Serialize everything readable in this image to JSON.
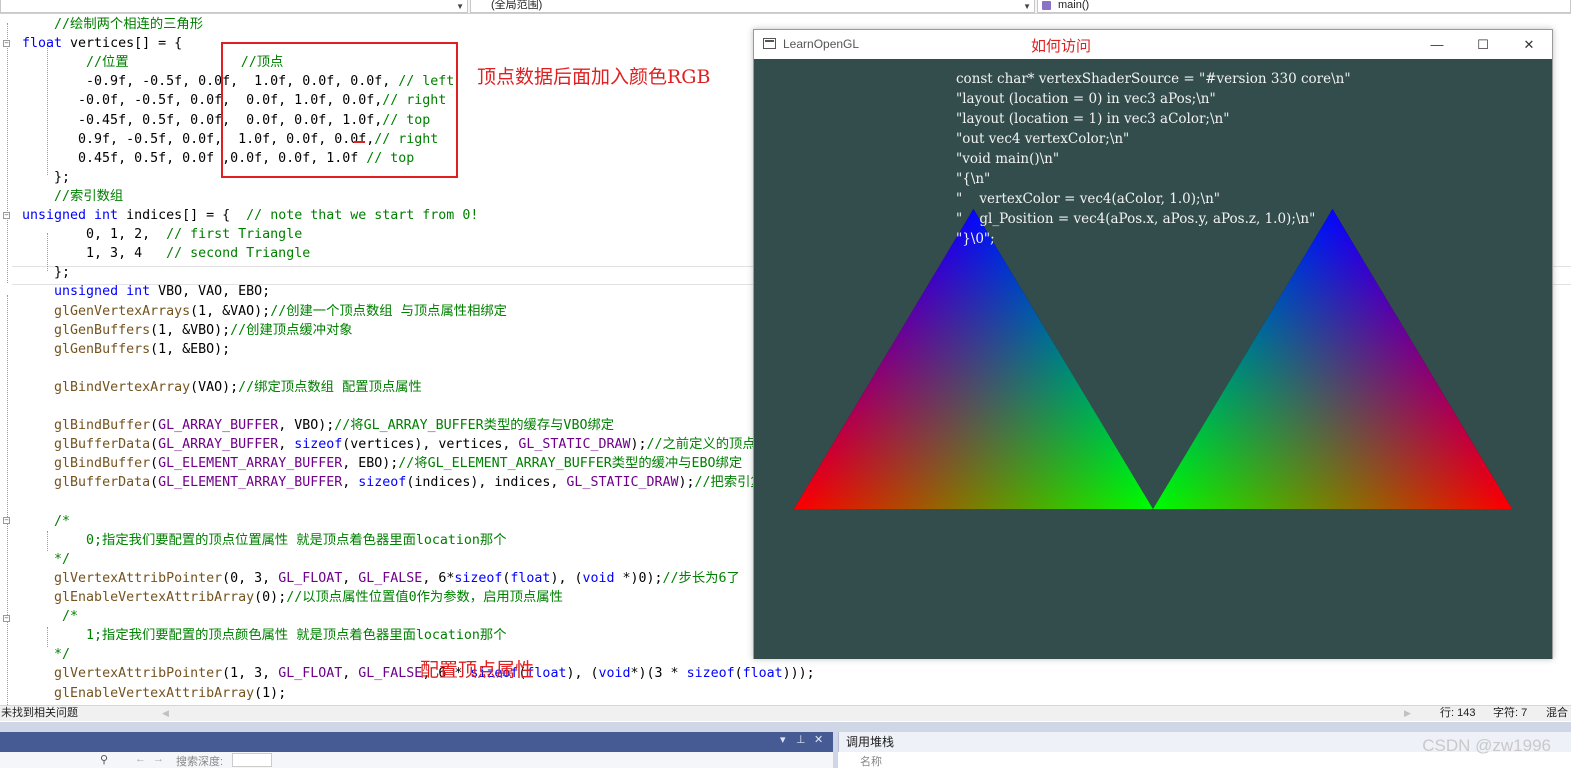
{
  "navbar": {
    "scope_combo": "(全局范围)",
    "function_combo": "main()"
  },
  "code_lines": [
    {
      "t": "    //绘制两个相连的三角形",
      "cls": "c-cm"
    },
    {
      "t": "    float vertices[] = {",
      "parts": [
        [
          "float",
          "c-kw"
        ],
        [
          " vertices[] = {",
          ""
        ]
      ]
    },
    {
      "t": "        //位置              //顶点",
      "cls": "c-cm"
    },
    {
      "t": "        -0.9f, -0.5f, 0.0f,  1.0f, 0.0f, 0.0f, // left",
      "parts": [
        [
          "        -0.9f, -0.5f, 0.0f,  1.0f, 0.0f, 0.0f, ",
          ""
        ],
        [
          "// left",
          "c-cm"
        ]
      ]
    },
    {
      "t": "       -0.0f, -0.5f, 0.0f,  0.0f, 1.0f, 0.0f,// right",
      "parts": [
        [
          "       -0.0f, -0.5f, 0.0f,  0.0f, 1.0f, 0.0f,",
          ""
        ],
        [
          "// right",
          "c-cm"
        ]
      ]
    },
    {
      "t": "       -0.45f, 0.5f, 0.0f,  0.0f, 0.0f, 1.0f,// top",
      "parts": [
        [
          "       -0.45f, 0.5f, 0.0f,  0.0f, 0.0f, 1.0f,",
          ""
        ],
        [
          "// top",
          "c-cm"
        ]
      ]
    },
    {
      "t": "       0.9f, -0.5f, 0.0f,  1.0f, 0.0f, 0.0f,// right",
      "parts": [
        [
          "       0.9f, -0.5f, 0.0f,  1.0f, 0.0f, 0.0f,",
          ""
        ],
        [
          "// right",
          "c-cm"
        ]
      ]
    },
    {
      "t": "       0.45f, 0.5f, 0.0f ,0.0f, 0.0f, 1.0f // top",
      "parts": [
        [
          "       0.45f, 0.5f, 0.0f ,0.0f, 0.0f, 1.0f ",
          ""
        ],
        [
          "// top",
          "c-cm"
        ]
      ]
    },
    {
      "t": "    };",
      "cls": ""
    },
    {
      "t": "    //索引数组",
      "cls": "c-cm"
    },
    {
      "t": "    unsigned int indices[] = {  // note that we start from 0!",
      "parts": [
        [
          "unsigned int",
          "c-kw"
        ],
        [
          " indices[] = {  ",
          ""
        ],
        [
          "// note that we start from 0!",
          "c-cm"
        ]
      ]
    },
    {
      "t": "        0, 1, 2,  // first Triangle",
      "parts": [
        [
          "        0, 1, 2,  ",
          ""
        ],
        [
          "// first Triangle",
          "c-cm"
        ]
      ]
    },
    {
      "t": "        1, 3, 4   // second Triangle",
      "parts": [
        [
          "        1, 3, 4   ",
          ""
        ],
        [
          "// second Triangle",
          "c-cm"
        ]
      ]
    },
    {
      "t": "    };",
      "cls": ""
    },
    {
      "t": "    unsigned int VBO, VAO, EBO;",
      "parts": [
        [
          "    ",
          ""
        ],
        [
          "unsigned int",
          "c-kw"
        ],
        [
          " VBO, VAO, EBO;",
          ""
        ]
      ]
    },
    {
      "t": "    glGenVertexArrays(1, &VAO);//创建一个顶点数组 与顶点属性相绑定",
      "parts": [
        [
          "    ",
          ""
        ],
        [
          "glGenVertexArrays",
          "c-fn"
        ],
        [
          "(1, &VAO);",
          ""
        ],
        [
          "//创建一个顶点数组 与顶点属性相绑定",
          "c-cm"
        ]
      ]
    },
    {
      "t": "    glGenBuffers(1, &VBO);//创建顶点缓冲对象",
      "parts": [
        [
          "    ",
          ""
        ],
        [
          "glGenBuffers",
          "c-fn"
        ],
        [
          "(1, &VBO);",
          ""
        ],
        [
          "//创建顶点缓冲对象",
          "c-cm"
        ]
      ]
    },
    {
      "t": "    glGenBuffers(1, &EBO);",
      "parts": [
        [
          "    ",
          ""
        ],
        [
          "glGenBuffers",
          "c-fn"
        ],
        [
          "(1, &EBO);",
          ""
        ]
      ]
    },
    {
      "t": "",
      "cls": ""
    },
    {
      "t": "    glBindVertexArray(VAO);//绑定顶点数组 配置顶点属性",
      "parts": [
        [
          "    ",
          ""
        ],
        [
          "glBindVertexArray",
          "c-fn"
        ],
        [
          "(VAO);",
          ""
        ],
        [
          "//绑定顶点数组 配置顶点属性",
          "c-cm"
        ]
      ]
    },
    {
      "t": "",
      "cls": ""
    },
    {
      "t": "    glBindBuffer(GL_ARRAY_BUFFER, VBO);//将GL_ARRAY_BUFFER类型的缓存与VBO绑定",
      "parts": [
        [
          "    ",
          ""
        ],
        [
          "glBindBuffer",
          "c-fn"
        ],
        [
          "(",
          ""
        ],
        [
          "GL_ARRAY_BUFFER",
          "c-mac"
        ],
        [
          ", VBO);",
          ""
        ],
        [
          "//将GL_ARRAY_BUFFER类型的缓存与VBO绑定",
          "c-cm"
        ]
      ]
    },
    {
      "t": "    glBufferData(GL_ARRAY_BUFFER, sizeof(vertices), vertices, GL_STATIC_DRAW);//之前定义的顶点数",
      "parts": [
        [
          "    ",
          ""
        ],
        [
          "glBufferData",
          "c-fn"
        ],
        [
          "(",
          ""
        ],
        [
          "GL_ARRAY_BUFFER",
          "c-mac"
        ],
        [
          ", ",
          ""
        ],
        [
          "sizeof",
          "c-kw"
        ],
        [
          "(vertices), vertices, ",
          ""
        ],
        [
          "GL_STATIC_DRAW",
          "c-mac"
        ],
        [
          ");",
          ""
        ],
        [
          "//之前定义的顶点数",
          "c-cm"
        ]
      ]
    },
    {
      "t": "    glBindBuffer(GL_ELEMENT_ARRAY_BUFFER, EBO);//将GL_ELEMENT_ARRAY_BUFFER类型的缓冲与EBO绑定",
      "parts": [
        [
          "    ",
          ""
        ],
        [
          "glBindBuffer",
          "c-fn"
        ],
        [
          "(",
          ""
        ],
        [
          "GL_ELEMENT_ARRAY_BUFFER",
          "c-mac"
        ],
        [
          ", EBO);",
          ""
        ],
        [
          "//将GL_ELEMENT_ARRAY_BUFFER类型的缓冲与EBO绑定",
          "c-cm"
        ]
      ]
    },
    {
      "t": "    glBufferData(GL_ELEMENT_ARRAY_BUFFER, sizeof(indices), indices, GL_STATIC_DRAW);//把索引复制",
      "parts": [
        [
          "    ",
          ""
        ],
        [
          "glBufferData",
          "c-fn"
        ],
        [
          "(",
          ""
        ],
        [
          "GL_ELEMENT_ARRAY_BUFFER",
          "c-mac"
        ],
        [
          ", ",
          ""
        ],
        [
          "sizeof",
          "c-kw"
        ],
        [
          "(indices), indices, ",
          ""
        ],
        [
          "GL_STATIC_DRAW",
          "c-mac"
        ],
        [
          ");",
          ""
        ],
        [
          "//把索引复制",
          "c-cm"
        ]
      ]
    },
    {
      "t": "",
      "cls": ""
    },
    {
      "t": "    /*",
      "cls": "c-cm"
    },
    {
      "t": "        0;指定我们要配置的顶点位置属性 就是顶点着色器里面location那个",
      "cls": "c-cm"
    },
    {
      "t": "    */",
      "cls": "c-cm"
    },
    {
      "t": "    glVertexAttribPointer(0, 3, GL_FLOAT, GL_FALSE, 6*sizeof(float), (void *)0);//步长为6了",
      "parts": [
        [
          "    ",
          ""
        ],
        [
          "glVertexAttribPointer",
          "c-fn"
        ],
        [
          "(0, 3, ",
          ""
        ],
        [
          "GL_FLOAT",
          "c-mac"
        ],
        [
          ", ",
          ""
        ],
        [
          "GL_FALSE",
          "c-mac"
        ],
        [
          ", 6*",
          ""
        ],
        [
          "sizeof",
          "c-kw"
        ],
        [
          "(",
          ""
        ],
        [
          "float",
          "c-kw"
        ],
        [
          "), (",
          ""
        ],
        [
          "void",
          "c-kw"
        ],
        [
          " *)0);",
          ""
        ],
        [
          "//步长为6了",
          "c-cm"
        ]
      ]
    },
    {
      "t": "    glEnableVertexAttribArray(0);//以顶点属性位置值0作为参数，启用顶点属性",
      "parts": [
        [
          "    ",
          ""
        ],
        [
          "glEnableVertexAttribArray",
          "c-fn"
        ],
        [
          "(0);",
          ""
        ],
        [
          "//以顶点属性位置值0作为参数，启用顶点属性",
          "c-cm"
        ]
      ]
    },
    {
      "t": "     /*",
      "cls": "c-cm"
    },
    {
      "t": "        1;指定我们要配置的顶点颜色属性 就是顶点着色器里面location那个",
      "cls": "c-cm"
    },
    {
      "t": "    */",
      "cls": "c-cm"
    },
    {
      "t": "    glVertexAttribPointer(1, 3, GL_FLOAT, GL_FALSE, 6 * sizeof(float), (void*)(3 * sizeof(float)));",
      "parts": [
        [
          "    ",
          ""
        ],
        [
          "glVertexAttribPointer",
          "c-fn"
        ],
        [
          "(1, 3, ",
          ""
        ],
        [
          "GL_FLOAT",
          "c-mac"
        ],
        [
          ", ",
          ""
        ],
        [
          "GL_FALSE",
          "c-mac"
        ],
        [
          ", 6 * ",
          ""
        ],
        [
          "sizeof",
          "c-kw"
        ],
        [
          "(",
          ""
        ],
        [
          "float",
          "c-kw"
        ],
        [
          "), (",
          ""
        ],
        [
          "void",
          "c-kw"
        ],
        [
          "*)(3 * ",
          ""
        ],
        [
          "sizeof",
          "c-kw"
        ],
        [
          "(",
          ""
        ],
        [
          "float",
          "c-kw"
        ],
        [
          ")));",
          ""
        ]
      ]
    },
    {
      "t": "    glEnableVertexAttribArray(1);",
      "parts": [
        [
          "    ",
          ""
        ],
        [
          "glEnableVertexAttribArray",
          "c-fn"
        ],
        [
          "(1);",
          ""
        ]
      ]
    }
  ],
  "annotations": {
    "color_note": "顶点数据后面加入颜色RGB",
    "how_access": "如何访问",
    "configure_attrib": "配置顶点属性"
  },
  "gl_window": {
    "title": "LearnOpenGL",
    "minimize": "—",
    "maximize": "☐",
    "close": "✕",
    "shader_lines": [
      "const char* vertexShaderSource = \"#version 330 core\\n\"",
      "\"layout (location = 0) in vec3 aPos;\\n\"",
      "\"layout (location = 1) in vec3 aColor;\\n\"",
      "\"out vec4 vertexColor;\\n\"",
      "\"void main()\\n\"",
      "\"{\\n\"",
      "\"    vertexColor = vec4(aColor, 1.0);\\n\"",
      "\"    gl_Position = vec4(aPos.x, aPos.y, aPos.z, 1.0);\\n\"",
      "\"}\\0\";"
    ],
    "clear_color": "#334d4d",
    "triangles": [
      {
        "vertices": [
          [
            -0.9,
            -0.5
          ],
          [
            0.0,
            -0.5
          ],
          [
            -0.45,
            0.5
          ]
        ],
        "colors": [
          "#ff0000",
          "#00ff00",
          "#0000ff"
        ]
      },
      {
        "vertices": [
          [
            0.9,
            -0.5
          ],
          [
            0.0,
            -0.5
          ],
          [
            0.45,
            0.5
          ]
        ],
        "colors": [
          "#ff0000",
          "#00ff00",
          "#0000ff"
        ]
      }
    ]
  },
  "statusbar": {
    "problems": "未找到相关问题",
    "line": "行: 143",
    "col": "字符: 7",
    "mode": "混合"
  },
  "bottom": {
    "right_header": "调用堆栈",
    "left_search": "搜索深度:",
    "right_col": "名称",
    "watermark": "CSDN @zw1996"
  }
}
